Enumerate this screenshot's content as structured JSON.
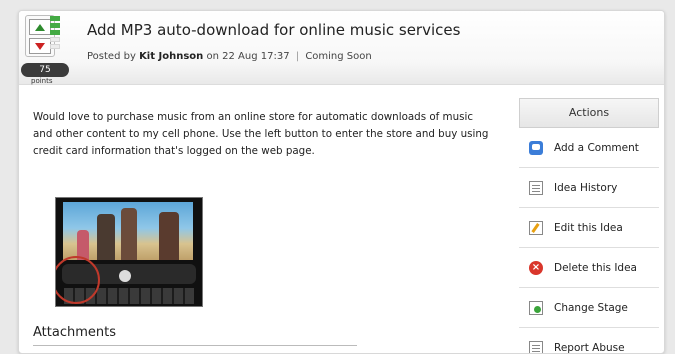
{
  "idea": {
    "title": "Add MP3 auto-download for online music services",
    "byline_prefix": "Posted by",
    "author": "Kit Johnson",
    "on_word": "on",
    "date": "22 Aug 17:37",
    "separator": "|",
    "stage": "Coming Soon",
    "points": "75",
    "points_label": "points",
    "description": "Would love to purchase music from an online store for automatic downloads of music and other content to my cell phone. Use the left button to enter the store and buy using credit card information that's logged on the web page."
  },
  "attachments": {
    "title": "Attachments"
  },
  "actions": {
    "header": "Actions",
    "items": [
      {
        "label": "Add a Comment",
        "icon": "comment-icon"
      },
      {
        "label": "Idea History",
        "icon": "history-icon"
      },
      {
        "label": "Edit this Idea",
        "icon": "edit-icon"
      },
      {
        "label": "Delete this Idea",
        "icon": "delete-icon"
      },
      {
        "label": "Change Stage",
        "icon": "change-stage-icon"
      },
      {
        "label": "Report Abuse",
        "icon": "report-abuse-icon"
      }
    ]
  },
  "vote": {
    "up_icon": "vote-up-icon",
    "down_icon": "vote-down-icon"
  }
}
